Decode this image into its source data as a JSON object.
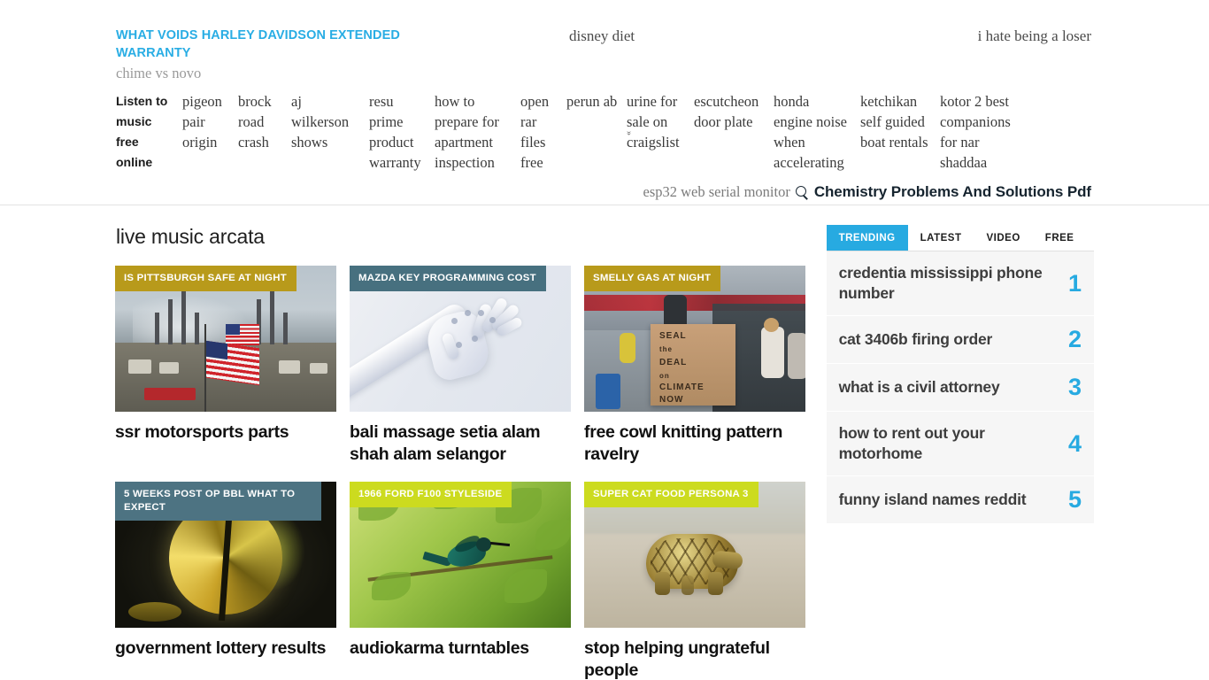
{
  "header": {
    "brand_link": "WHAT VOIDS HARLEY DAVIDSON EXTENDED WARRANTY",
    "brand_sub": "chime vs novo",
    "center_link": "disney diet",
    "right_link": "i hate being a loser"
  },
  "nav": {
    "items": [
      {
        "label": "Listen to music free online",
        "bold": true,
        "chevron": false
      },
      {
        "label": "pigeon pair origin",
        "bold": false,
        "chevron": false
      },
      {
        "label": "brock road crash",
        "bold": false,
        "chevron": false
      },
      {
        "label": "aj wilkerson shows",
        "bold": false,
        "chevron": false
      },
      {
        "label": "resu prime product warranty",
        "bold": false,
        "chevron": false
      },
      {
        "label": "how to prepare for apartment inspection",
        "bold": false,
        "chevron": false
      },
      {
        "label": "open rar files free",
        "bold": false,
        "chevron": false
      },
      {
        "label": "perun ab",
        "bold": false,
        "chevron": false
      },
      {
        "label": "urine for sale on craigslist",
        "bold": false,
        "chevron": true
      },
      {
        "label": "escutcheon door plate",
        "bold": false,
        "chevron": false
      },
      {
        "label": "honda engine noise when accelerating",
        "bold": false,
        "chevron": false
      },
      {
        "label": "ketchikan self guided boat rentals",
        "bold": false,
        "chevron": false
      },
      {
        "label": "kotor 2 best companions for nar shaddaa",
        "bold": false,
        "chevron": false
      }
    ]
  },
  "search": {
    "keyword": "esp32 web serial monitor",
    "icon": "search-icon",
    "title": "Chemistry Problems And Solutions Pdf"
  },
  "main": {
    "section_title": "live music arcata",
    "cards": [
      {
        "badge": "IS PITTSBURGH SAFE AT NIGHT",
        "badge_color": "#b89a1b",
        "title": "ssr motorsports parts",
        "art": "refinery"
      },
      {
        "badge": "MAZDA KEY PROGRAMMING COST",
        "badge_color": "#47707f",
        "title": "bali massage setia alam shah alam selangor",
        "art": "robot"
      },
      {
        "badge": "SMELLY GAS AT NIGHT",
        "badge_color": "#b89a1b",
        "title": "free cowl knitting pattern ravelry",
        "art": "protest"
      },
      {
        "badge": "5 WEEKS POST OP BBL WHAT TO EXPECT",
        "badge_color": "#4d7382",
        "title": "government lottery results",
        "art": "coin"
      },
      {
        "badge": "1966 FORD F100 STYLESIDE",
        "badge_color": "#ccdb1f",
        "title": "audiokarma turntables",
        "art": "bird"
      },
      {
        "badge": "SUPER CAT FOOD PERSONA 3",
        "badge_color": "#ccdb1f",
        "title": "stop helping ungrateful people",
        "art": "tortoise"
      }
    ]
  },
  "sidebar": {
    "tabs": [
      {
        "label": "TRENDING",
        "active": true
      },
      {
        "label": "LATEST",
        "active": false
      },
      {
        "label": "VIDEO",
        "active": false
      },
      {
        "label": "FREE",
        "active": false
      }
    ],
    "accent_color": "#27aae1",
    "trending": [
      {
        "text": "credentia mississippi phone number",
        "rank": "1"
      },
      {
        "text": "cat 3406b firing order",
        "rank": "2"
      },
      {
        "text": "what is a civil attorney",
        "rank": "3"
      },
      {
        "text": "how to rent out your motorhome",
        "rank": "4"
      },
      {
        "text": "funny island names reddit",
        "rank": "5"
      }
    ]
  }
}
